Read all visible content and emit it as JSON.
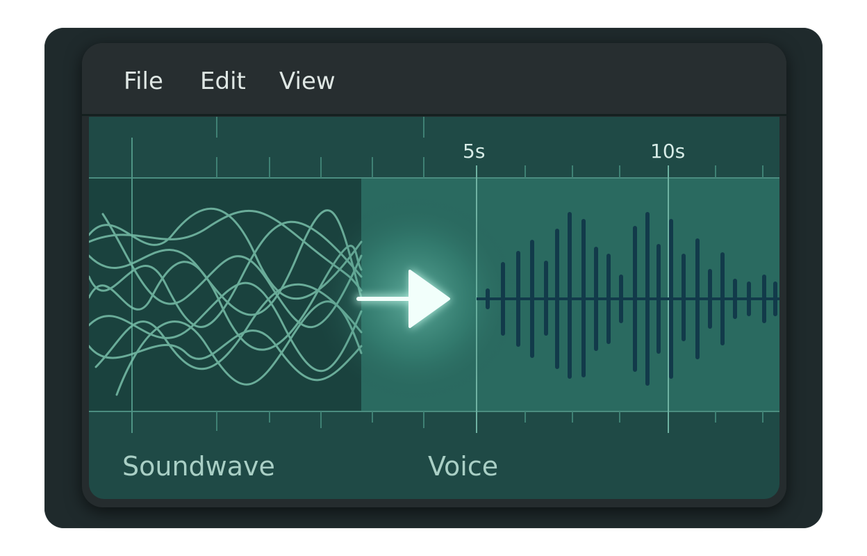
{
  "menu": {
    "items": [
      {
        "label": "File"
      },
      {
        "label": "Edit"
      },
      {
        "label": "View"
      }
    ]
  },
  "timeline": {
    "ticks": [
      {
        "label": "5s"
      },
      {
        "label": "10s"
      }
    ]
  },
  "tracks": {
    "left_label": "Soundwave",
    "right_label": "Voice"
  },
  "icons": {
    "transform": "arrow-right-icon"
  },
  "colors": {
    "panel": "#1f4a46",
    "soundwave": "#7fc8b3",
    "voice": "#123a4a",
    "arrow": "#f2fffb"
  }
}
